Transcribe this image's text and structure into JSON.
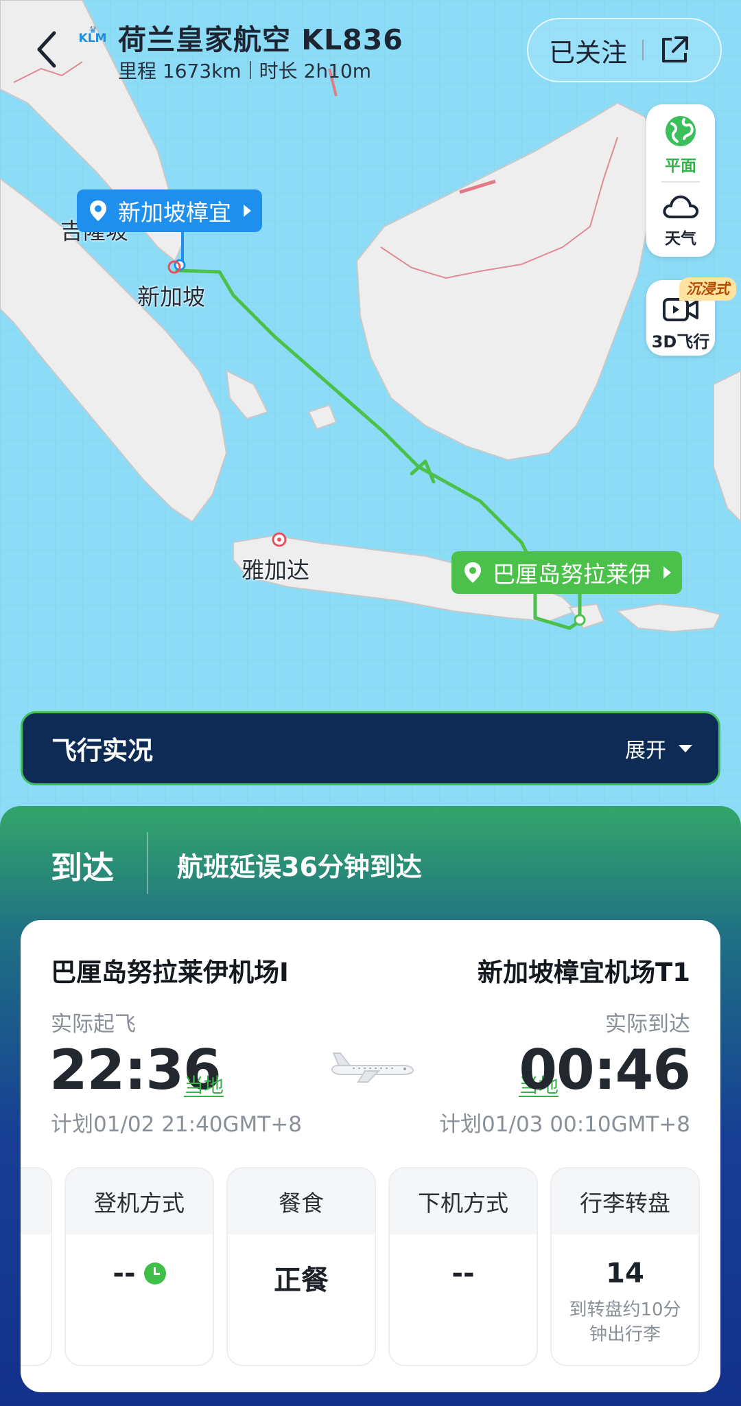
{
  "header": {
    "airline_logo_text": "KLM",
    "title": "荷兰皇家航空 KL836",
    "distance": "里程 1673km",
    "duration": "时长 2h10m",
    "follow_label": "已关注"
  },
  "map_tools": {
    "flat_label": "平面",
    "weather_label": "天气",
    "immersive_badge": "沉浸式",
    "fly3d_label": "3D飞行"
  },
  "map": {
    "departure_callout": "新加坡樟宜",
    "arrival_callout": "巴厘岛努拉莱伊",
    "labels": [
      "吉隆坡",
      "新加坡",
      "雅加达"
    ]
  },
  "live": {
    "title": "飞行实况",
    "expand_label": "展开"
  },
  "status": {
    "state": "到达",
    "detail": "航班延误36分钟到达"
  },
  "flight": {
    "departure": {
      "airport": "巴厘岛努拉莱伊机场I",
      "label": "实际起飞",
      "time": "22:36",
      "local": "当地",
      "scheduled": "计划01/02 21:40GMT+8"
    },
    "arrival": {
      "airport": "新加坡樟宜机场T1",
      "label": "实际到达",
      "time": "00:46",
      "local": "当地",
      "scheduled": "计划01/03 00:10GMT+8"
    }
  },
  "tiles": [
    {
      "title": "登机方式",
      "value": "--",
      "note": ""
    },
    {
      "title": "餐食",
      "value": "正餐",
      "note": ""
    },
    {
      "title": "下机方式",
      "value": "--",
      "note": ""
    },
    {
      "title": "行李转盘",
      "value": "14",
      "note": "到转盘约10分钟出行李"
    }
  ],
  "colors": {
    "route_green": "#4bc04a",
    "departure_blue": "#1f8fed",
    "live_bar_bg": "#0d2b55"
  }
}
